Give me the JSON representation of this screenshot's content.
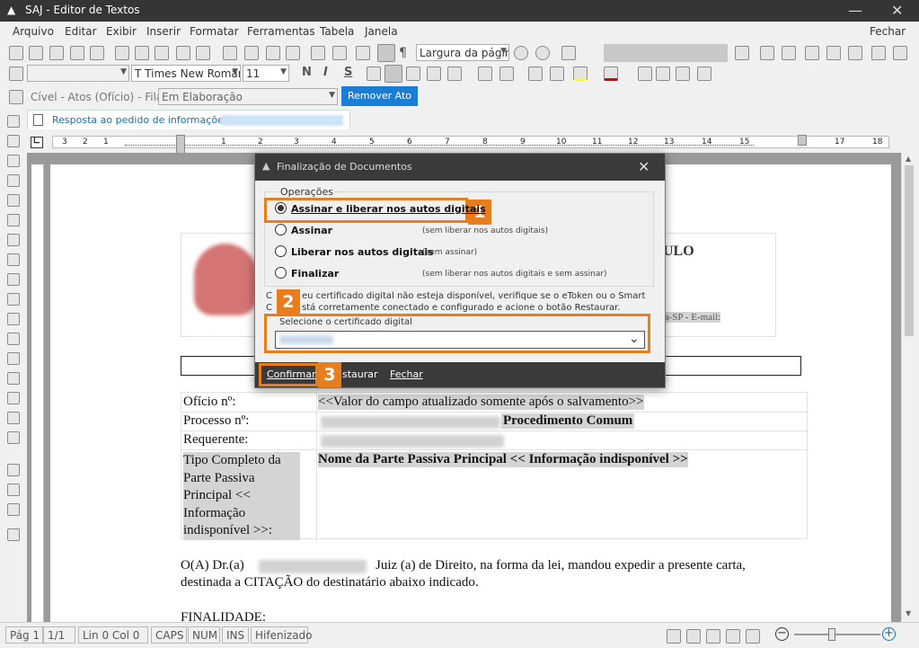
{
  "window": {
    "title": "SAJ - Editor de Textos",
    "close_glyph": "✕",
    "minimize_glyph": "—"
  },
  "menu": {
    "items": [
      "Arquivo",
      "Editar",
      "Exibir",
      "Inserir",
      "Formatar",
      "Ferramentas",
      "Tabela",
      "Janela"
    ],
    "right": "Fechar"
  },
  "toolbar": {
    "zoom": "Largura da págin",
    "font": "Times New Romar",
    "size": "11",
    "bold": "N",
    "italic": "I",
    "strike": "S",
    "style_s": "S"
  },
  "act_bar": {
    "label": "Cível - Atos (Ofício) - Fila:",
    "queue": "Em Elaboração",
    "remove_button": "Remover Ato"
  },
  "doc_tab": {
    "label": "Resposta ao pedido de informações"
  },
  "ruler": {
    "marks": [
      "3",
      "2",
      "1",
      "1",
      "2",
      "3",
      "4",
      "5",
      "6",
      "7",
      "8",
      "9",
      "10",
      "11",
      "12",
      "13",
      "14",
      "15",
      "16",
      "17",
      "18"
    ]
  },
  "document": {
    "header_text": "ULO",
    "header_line": "ra-SP - E-mail:",
    "rows": [
      {
        "label": "Ofício nº:",
        "value": "<<Valor do campo atualizado somente após o salvamento>>"
      },
      {
        "label": "Processo nº:",
        "value": "Procedimento Comum"
      },
      {
        "label": "Requerente:",
        "value": ""
      },
      {
        "label": "Tipo Completo da Parte Passiva Principal << Informação indisponível >>:",
        "value": "Nome da Parte Passiva Principal << Informação indisponível >>"
      }
    ],
    "para_prefix": "O(A) Dr.(a)",
    "para_suffix": "Juiz (a) de Direito, na forma da lei, mandou expedir a presente carta,",
    "para_line2": "destinada a CITAÇÃO do destinatário abaixo indicado.",
    "finalidade": "FINALIDADE:"
  },
  "dialog": {
    "title": "Finalização de Documentos",
    "group_label": "Operações",
    "options": [
      {
        "label": "Assinar e liberar nos autos digitais",
        "note": "",
        "checked": true
      },
      {
        "label": "Assinar",
        "note": "(sem liberar nos autos digitais)",
        "checked": false
      },
      {
        "label": "Liberar nos autos digitais",
        "note": "(sem assinar)",
        "checked": false
      },
      {
        "label": "Finalizar",
        "note": "(sem liberar nos autos digitais e sem assinar)",
        "checked": false
      }
    ],
    "info_line1": "eu certificado digital não esteja disponível, verifique se o eToken ou o Smart",
    "info_line2": "stá corretamente conectado e configurado e acione o botão Restaurar.",
    "info_prefix1": "C",
    "info_prefix2": "C",
    "cert_label": "Selecione o certificado digital",
    "buttons": {
      "confirm": "Confirmar",
      "restore": "staurar",
      "close": "Fechar"
    },
    "badges": [
      "1",
      "2",
      "3"
    ]
  },
  "status": {
    "page": "Pág 1",
    "pages": "1/1",
    "position": "Lin 0  Col 0",
    "caps": "CAPS",
    "num": "NUM",
    "ins": "INS",
    "hyphen": "Hifenizado",
    "zoom_out": "−",
    "zoom_in": "+"
  }
}
